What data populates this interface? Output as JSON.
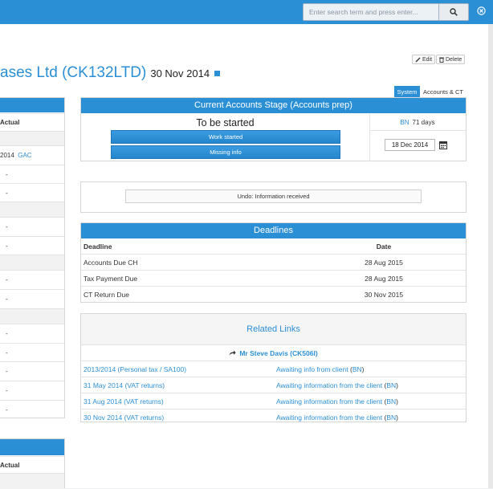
{
  "header": {
    "search_placeholder": "Enter search term and press enter...",
    "search_icon": "search-icon",
    "close_icon": "close-circle-icon"
  },
  "title": {
    "company": "ases Ltd (CK132LTD)",
    "date": "30 Nov 2014"
  },
  "actions": {
    "edit": "Edit",
    "delete": "Delete"
  },
  "tabs": {
    "system": "System",
    "accounts_ct": "Accounts & CT"
  },
  "left_panel": {
    "header": "Actual",
    "first_row_year": "2014",
    "first_row_code": "GAC",
    "dash": "-",
    "lower_header": "Actual"
  },
  "stage": {
    "heading": "Current Accounts Stage (Accounts prep)",
    "status": "To be started",
    "assignee": "BN",
    "days": "71 days",
    "work_started": "Work started",
    "missing_info": "Missing info",
    "date": "18 Dec 2014"
  },
  "undo": {
    "label": "Undo: Information received"
  },
  "deadlines": {
    "heading": "Deadlines",
    "col_deadline": "Deadline",
    "col_date": "Date",
    "rows": [
      {
        "name": "Accounts Due CH",
        "date": "28 Aug 2015"
      },
      {
        "name": "Tax Payment Due",
        "date": "28 Aug 2015"
      },
      {
        "name": "CT Return Due",
        "date": "30 Nov 2015"
      }
    ]
  },
  "related": {
    "heading": "Related Links",
    "person": "Mr Steve Davis (CK506I)",
    "rows": [
      {
        "link": "2013/2014 (Personal tax / SA100)",
        "status": "Awaiting info from client",
        "who": "BN"
      },
      {
        "link": "31 May 2014 (VAT returns)",
        "status": "Awaiting information from the client",
        "who": "BN"
      },
      {
        "link": "31 Aug 2014 (VAT returns)",
        "status": "Awaiting information from the client",
        "who": "BN"
      },
      {
        "link": "30 Nov 2014 (VAT returns)",
        "status": "Awaiting information from the client",
        "who": "BN"
      }
    ]
  }
}
